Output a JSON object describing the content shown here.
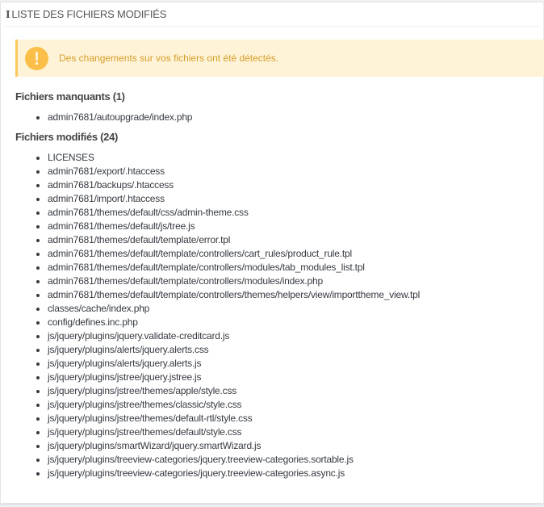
{
  "panel": {
    "title": "LISTE DES FICHIERS MODIFIÉS",
    "icon": "info-icon"
  },
  "alert": {
    "icon": "exclamation-icon",
    "message": "Des changements sur vos fichiers ont été détectés.",
    "color": "#fbbf49"
  },
  "missing": {
    "heading": "Fichiers manquants (1)",
    "files": [
      "admin7681/autoupgrade/index.php"
    ]
  },
  "modified": {
    "heading": "Fichiers modifiés (24)",
    "files": [
      "LICENSES",
      "admin7681/export/.htaccess",
      "admin7681/backups/.htaccess",
      "admin7681/import/.htaccess",
      "admin7681/themes/default/css/admin-theme.css",
      "admin7681/themes/default/js/tree.js",
      "admin7681/themes/default/template/error.tpl",
      "admin7681/themes/default/template/controllers/cart_rules/product_rule.tpl",
      "admin7681/themes/default/template/controllers/modules/tab_modules_list.tpl",
      "admin7681/themes/default/template/controllers/modules/index.php",
      "admin7681/themes/default/template/controllers/themes/helpers/view/importtheme_view.tpl",
      "classes/cache/index.php",
      "config/defines.inc.php",
      "js/jquery/plugins/jquery.validate-creditcard.js",
      "js/jquery/plugins/alerts/jquery.alerts.css",
      "js/jquery/plugins/alerts/jquery.alerts.js",
      "js/jquery/plugins/jstree/jquery.jstree.js",
      "js/jquery/plugins/jstree/themes/apple/style.css",
      "js/jquery/plugins/jstree/themes/classic/style.css",
      "js/jquery/plugins/jstree/themes/default-rtl/style.css",
      "js/jquery/plugins/jstree/themes/default/style.css",
      "js/jquery/plugins/smartWizard/jquery.smartWizard.js",
      "js/jquery/plugins/treeview-categories/jquery.treeview-categories.sortable.js",
      "js/jquery/plugins/treeview-categories/jquery.treeview-categories.async.js"
    ]
  }
}
